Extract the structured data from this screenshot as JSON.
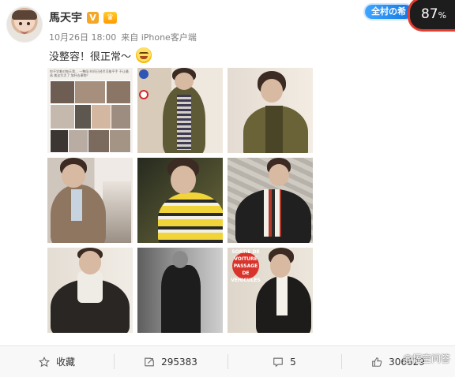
{
  "header": {
    "user_name": "馬天宇",
    "verified_glyph": "V",
    "vip_glyph": "♛",
    "timestamp": "10月26日 18:00",
    "source": "来自 iPhone客户端",
    "post_text": "没整容！很正常～",
    "emoji": "grinning-face"
  },
  "overlay": {
    "pill_text": "全村の希",
    "percent": "87",
    "percent_unit": "%",
    "watermark": "@悟空问答"
  },
  "collage_caption": "你不学着对每天我…  一整段 时间已经尽可能平手  不让最具  美这生活了  加杯去事物？",
  "stamp_text": "SORTIE DE VOITURE PASSAGE DE VEHICULES",
  "actions": [
    {
      "icon": "star-icon",
      "label": "收藏"
    },
    {
      "icon": "repost-icon",
      "label": "295383"
    },
    {
      "icon": "comment-icon",
      "label": "5"
    },
    {
      "icon": "like-icon",
      "label": "306629"
    }
  ],
  "colors": {
    "accent_blue": "#1676e0",
    "ring_red": "#e23d2f",
    "verified_orange": "#f5a623"
  }
}
